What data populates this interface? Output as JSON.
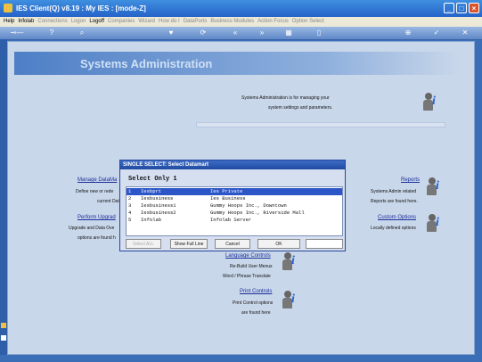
{
  "window": {
    "title": "IES Client(Q) v8.19 : My IES :      [mode-Z]",
    "buttons": [
      "minimize-icon",
      "maximize-icon",
      "close-icon"
    ]
  },
  "menu": [
    "Help",
    "Infolab",
    "Connections",
    "Logon",
    "Logoff",
    "Companies",
    "Wizard",
    "How do I",
    "DataPorts",
    "Business Modules",
    "Action Focus",
    "Option Select"
  ],
  "menu_active": [
    0,
    1,
    4
  ],
  "page": {
    "title": "Systems Administration",
    "intro_line1": "Systems Administration is for managing your",
    "intro_line2": "system settings and parameters."
  },
  "left_items": [
    {
      "link": "Manage DataMa",
      "desc1": "Define new or rede",
      "desc2": "current DataM"
    },
    {
      "link": "Perform Upgrad",
      "desc1": "Upgrade and Data Ove",
      "desc2": "options are found h"
    }
  ],
  "right_items": [
    {
      "link": "Reports",
      "desc1": "Systems Admin related",
      "desc2": "Reports are found here."
    },
    {
      "link": "Custom Options",
      "desc1": "Locally defined options",
      "desc2": ""
    }
  ],
  "center_items": [
    {
      "link": "Language Controls",
      "desc1": "Re-Build User Menus",
      "desc2": "Word / Phrase Translate"
    },
    {
      "link": "Print Controls",
      "desc1": "Print Control options",
      "desc2": "are found here"
    }
  ],
  "dialog": {
    "title": "SINGLE SELECT: Select Datamart",
    "heading": "Select Only 1",
    "rows": [
      {
        "num": "1",
        "code": "Iesbprt",
        "name": "Ies Private",
        "selected": true
      },
      {
        "num": "2",
        "code": "Iesbusiness",
        "name": "Ies Business",
        "selected": false
      },
      {
        "num": "3",
        "code": "Iesbusiness1",
        "name": "Gummy Hoops Inc., Downtown",
        "selected": false
      },
      {
        "num": "4",
        "code": "Iesbusiness2",
        "name": "Gummy Hoops Inc., Riverside Mall",
        "selected": false
      },
      {
        "num": "5",
        "code": "Infolab",
        "name": "Infolab Server",
        "selected": false
      }
    ],
    "buttons": {
      "select_all": "Select ALL",
      "show_full_line": "Show Full Line",
      "cancel": "Cancel",
      "ok": "OK"
    },
    "input_value": ""
  },
  "colors": {
    "accent": "#2c56c8",
    "link": "#1b2e9a",
    "background": "#c9d7ea"
  }
}
